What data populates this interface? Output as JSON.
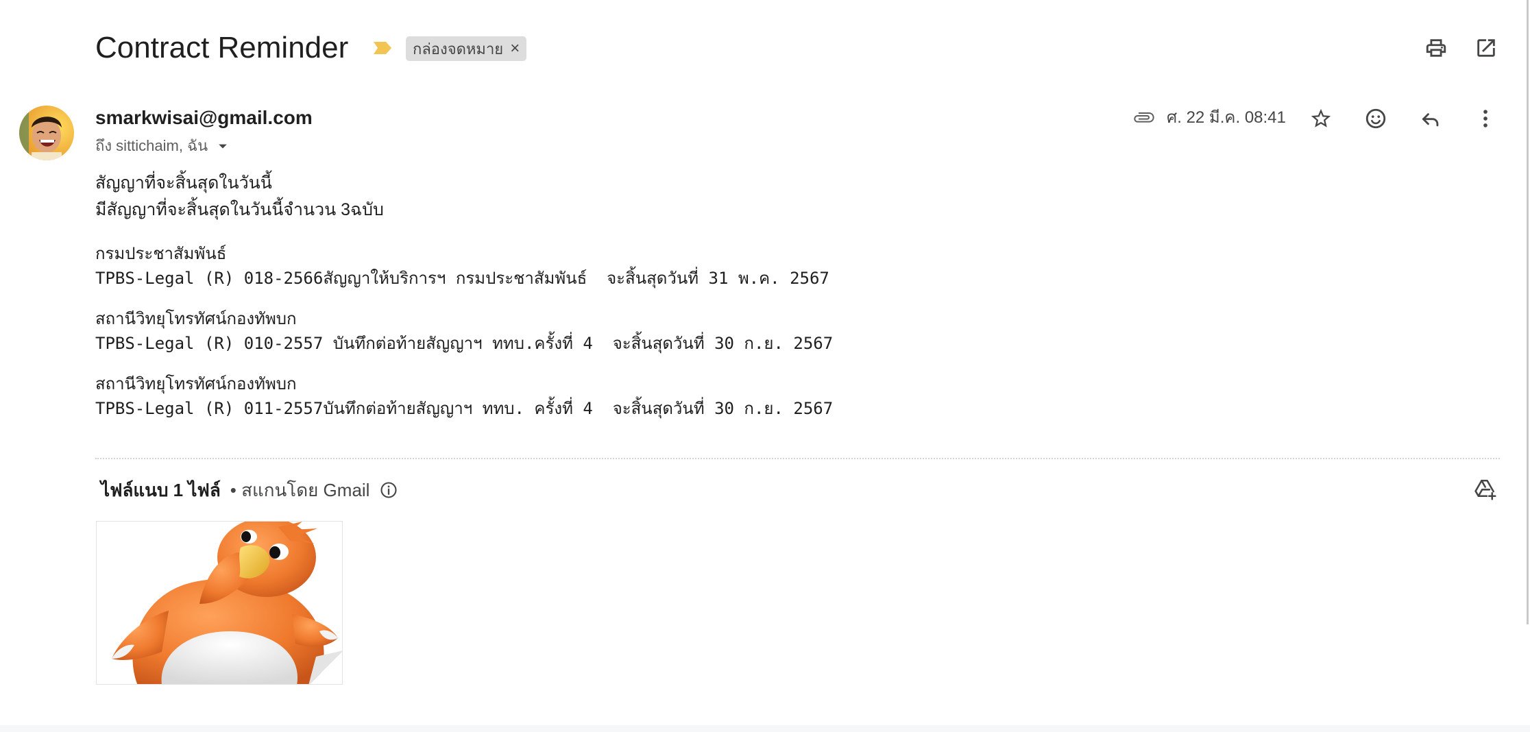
{
  "header": {
    "subject": "Contract Reminder",
    "importance_marker": {
      "icon": "importance-marker-icon"
    },
    "label_chip": {
      "label": "กล่องจดหมาย",
      "remove_glyph": "×"
    },
    "actions": {
      "print": "print-icon",
      "open_in_new_window": "open-in-new-icon"
    }
  },
  "message": {
    "sender_email": "smarkwisai@gmail.com",
    "recipients": "ถึง sittichaim, ฉัน",
    "recipients_dropdown_icon": "arrow-drop-down-icon",
    "attachment_indicator_icon": "paperclip-icon",
    "date": "ศ. 22 มี.ค. 08:41",
    "actions": [
      "star-icon",
      "add-reaction-icon",
      "reply-icon",
      "more-vert-icon"
    ],
    "body": {
      "title_lines": [
        "สัญญาที่จะสิ้นสุดในวันนี้",
        "มีสัญญาที่จะสิ้นสุดในวันนี้จำนวน 3ฉบับ"
      ],
      "contracts": [
        {
          "agency": "กรมประชาสัมพันธ์",
          "detail": "TPBS-Legal (R) 018-2566สัญญาให้บริการฯ กรมประชาสัมพันธ์  จะสิ้นสุดวันที่ 31 พ.ค. 2567"
        },
        {
          "agency": "สถานีวิทยุโทรทัศน์กองทัพบก",
          "detail": "TPBS-Legal (R) 010-2557 บันทึกต่อท้ายสัญญาฯ ททบ.ครั้งที่ 4  จะสิ้นสุดวันที่ 30 ก.ย. 2567"
        },
        {
          "agency": "สถานีวิทยุโทรทัศน์กองทัพบก",
          "detail": "TPBS-Legal (R) 011-2557บันทึกต่อท้ายสัญญาฯ ททบ. ครั้งที่ 4  จะสิ้นสุดวันที่ 30 ก.ย. 2567"
        }
      ]
    }
  },
  "attachments": {
    "heading": "ไฟล์แนบ 1 ไฟล์",
    "scan_note": "• สแกนโดย Gmail",
    "info_icon": "info-icon",
    "add_to_drive_icon": "add-to-drive-icon"
  },
  "colors": {
    "text_primary": "#1f1f1f",
    "text_secondary": "#444746",
    "label_chip_background": "#dddddd",
    "importance_marker": "#f2c553",
    "divider": "#d3d3d3"
  }
}
